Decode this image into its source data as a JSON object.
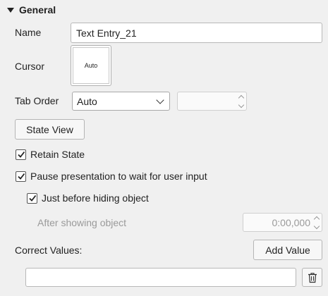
{
  "section": {
    "title": "General",
    "expand_icon": "triangle-down"
  },
  "name": {
    "label": "Name",
    "value": "Text Entry_21"
  },
  "cursor": {
    "label": "Cursor",
    "preview_text": "Auto"
  },
  "tab_order": {
    "label": "Tab Order",
    "selected": "Auto",
    "spinner_value": ""
  },
  "state_view_button": "State View",
  "retain_state": {
    "label": "Retain State",
    "checked": true
  },
  "pause_presentation": {
    "label": "Pause presentation to wait for user input",
    "checked": true
  },
  "just_before_hiding": {
    "label": "Just before hiding object",
    "checked": true
  },
  "after_showing": {
    "label": "After showing object",
    "time_value": "0:00,000"
  },
  "correct_values": {
    "label": "Correct Values:",
    "add_button": "Add Value",
    "input_value": "",
    "delete_icon": "trash-icon"
  }
}
